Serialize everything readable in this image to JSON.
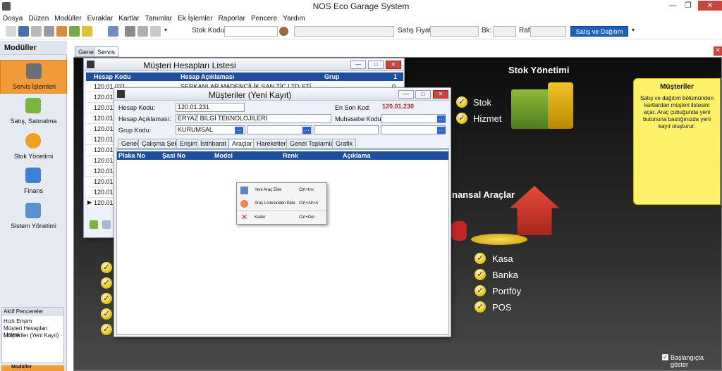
{
  "app": {
    "title": "NOS Eco Garage System"
  },
  "menu": [
    "Dosya",
    "Düzen",
    "Modüller",
    "Evraklar",
    "Kartlar",
    "Tanımlar",
    "Ek İşlemler",
    "Raporlar",
    "Pencere",
    "Yardım"
  ],
  "toolbar": {
    "stok_kodu_label": "Stok Kodu",
    "satis_fiyati_label": "Satış Fiyatı",
    "bk_label": "Bk:",
    "raf_label": "Raf",
    "satis_dagitim": "Satış ve Dağıtım"
  },
  "sidebar": {
    "header": "Modüller",
    "items": [
      {
        "label": "Servis İşlemleri",
        "icon": "tools-icon"
      },
      {
        "label": "Satış, Satınalma",
        "icon": "pencil-icon"
      },
      {
        "label": "Stok Yönetimi",
        "icon": "gear-icon"
      },
      {
        "label": "Finans",
        "icon": "folder-icon"
      },
      {
        "label": "Sistem Yönetimi",
        "icon": "settings-icon"
      }
    ],
    "aktif_header": "Aktif Pencereler",
    "aktif_items": [
      "Hızlı Erişim",
      "Müşteri Hesapları Listesi",
      "Müşteriler (Yeni Kayıt)"
    ],
    "footer": "Modüller"
  },
  "main_tabs": [
    "Genel",
    "Servis"
  ],
  "desktop": {
    "stok_title": "Stok Yönetimi",
    "stok_items": [
      "Stok",
      "Hizmet"
    ],
    "finans_title": "nansal Araçlar",
    "finans_items": [
      "Kasa",
      "Banka",
      "Portföy",
      "POS"
    ],
    "note_title": "Müşteriler",
    "note_body": "Satış ve dağıtım bölümünden kartlardan müşteri listesini açar. Araç çubuğunda yeni butonuna bastığınızda yeni kayıt oluşturur.",
    "startup_label": "Başlangıçta göster"
  },
  "list_window": {
    "title": "Müşteri Hesapları Listesi",
    "columns": [
      "Hesap Kodu",
      "Hesap Açıklaması",
      "Grup",
      "1"
    ],
    "rows": [
      {
        "kod": "120.01.021",
        "aciklama": "SERKANLAR MADENCİLİK SAN TİC LTD ŞTİ",
        "val": "0"
      },
      {
        "kod": "120.01.",
        "aciklama": "",
        "val": ""
      },
      {
        "kod": "120.01.",
        "aciklama": "",
        "val": ""
      },
      {
        "kod": "120.01.",
        "aciklama": "",
        "val": ""
      },
      {
        "kod": "120.01.",
        "aciklama": "",
        "val": ""
      },
      {
        "kod": "120.01.",
        "aciklama": "",
        "val": ""
      },
      {
        "kod": "120.01.",
        "aciklama": "",
        "val": ""
      },
      {
        "kod": "120.01.",
        "aciklama": "",
        "val": ""
      },
      {
        "kod": "120.01.",
        "aciklama": "",
        "val": ""
      },
      {
        "kod": "120.01.",
        "aciklama": "",
        "val": ""
      },
      {
        "kod": "120.01.",
        "aciklama": "",
        "val": ""
      },
      {
        "kod": "120.01.",
        "aciklama": "",
        "val": ""
      }
    ]
  },
  "form_window": {
    "title": "Müşteriler (Yeni Kayıt)",
    "hesap_kodu_label": "Hesap Kodu:",
    "hesap_kodu": "120.01.231",
    "en_son_kod_label": "En Son Kod:",
    "en_son_kod": "120.01.230",
    "hesap_aciklamasi_label": "Hesap Açıklaması:",
    "hesap_aciklamasi": "ERYAZ BİLGİ TEKNOLOJİLERİ",
    "muhasebe_kodu_label": "Muhasebe Kodu:",
    "grup_kodu_label": "Grup Kodu:",
    "grup_kodu": "KURUMSAL",
    "tabs": [
      "Genel",
      "Çalışma Şekli",
      "Erişim",
      "İstihbarat",
      "Araçlar",
      "Hareketler",
      "Genel Toplamlar",
      "Grafik"
    ],
    "active_tab": "Araçlar",
    "grid_columns": [
      "Plaka No",
      "Şasi No",
      "Model",
      "Renk",
      "Açıklama"
    ]
  },
  "context_menu": [
    {
      "label": "Yeni Araç Ekle",
      "shortcut": "Ctrl+Ins"
    },
    {
      "label": "Araç Listesinden Ekle",
      "shortcut": "Ctrl+Alt+A"
    },
    {
      "label": "Kaldır",
      "shortcut": "Ctrl+Del"
    }
  ]
}
